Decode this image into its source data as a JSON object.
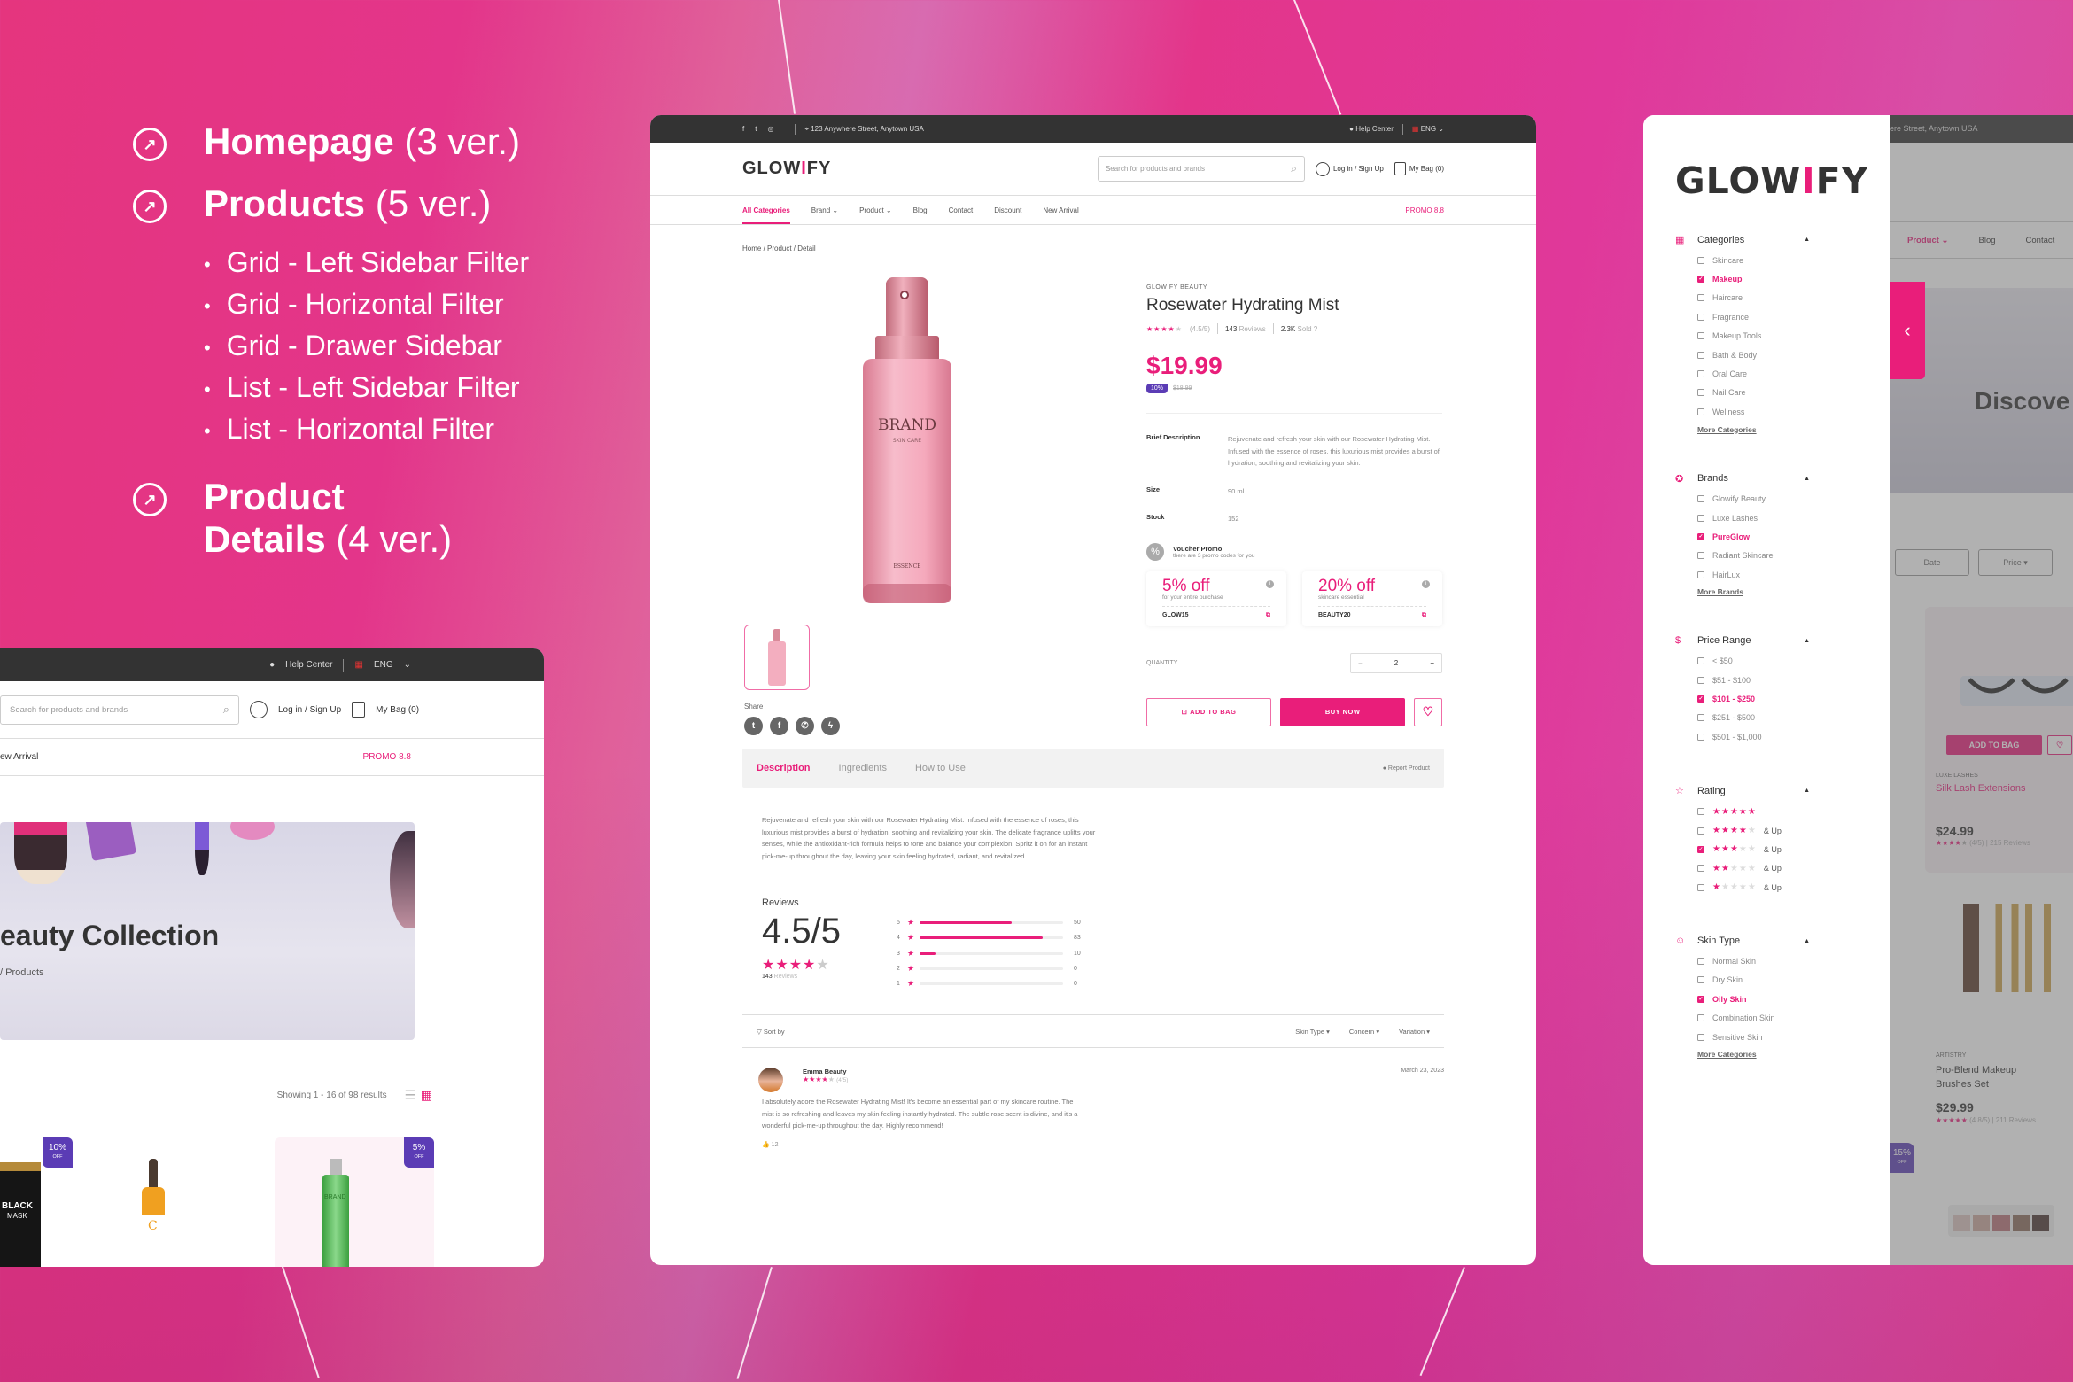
{
  "features": [
    {
      "title": "Homepage",
      "version": "(3 ver.)",
      "icon": "arrow-up-right-circle-icon",
      "items": []
    },
    {
      "title": "Products",
      "version": "(5 ver.)",
      "icon": "arrow-up-right-circle-icon",
      "items": [
        "Grid - Left Sidebar Filter",
        "Grid - Horizontal Filter",
        "Grid - Drawer Sidebar",
        "List - Left Sidebar Filter",
        "List - Horizontal Filter"
      ]
    },
    {
      "title": "Product",
      "title2": "Details",
      "version": "(4 ver.)",
      "icon": "arrow-up-right-circle-icon",
      "items": []
    }
  ],
  "brand": {
    "logo_pre": "GLOW",
    "logo_mark": "I",
    "logo_post": "FY",
    "accent": "#e91e7a",
    "badge_color": "#5b3cb5"
  },
  "topbar": {
    "address": "123 Anywhere Street, Anytown USA",
    "help": "Help Center",
    "lang": "ENG"
  },
  "header": {
    "search_placeholder": "Search for products and brands",
    "login": "Log in / Sign Up",
    "bag": "My Bag (0)"
  },
  "nav": {
    "items": [
      "All Categories",
      "Brand",
      "Product",
      "Blog",
      "Contact",
      "Discount",
      "New Arrival"
    ],
    "promo": "PROMO 8.8"
  },
  "detail": {
    "breadcrumb": "Home / Product / Detail",
    "image_text": {
      "brand": "BRAND",
      "line": "SKIN CARE",
      "essence": "ESSENCE"
    },
    "share_label": "Share",
    "brand": "GLOWIFY BEAUTY",
    "name": "Rosewater Hydrating Mist",
    "rating": 4.5,
    "rating_text": "(4.5/5)",
    "reviews_count": "143",
    "reviews_label": "Reviews",
    "sold": "2.3K",
    "sold_label": "Sold",
    "price": "$19.99",
    "discount": "10%",
    "old_price": "$18.99",
    "brief_label": "Brief Description",
    "brief": "Rejuvenate and refresh your skin with our Rosewater Hydrating Mist. Infused with the essence of roses, this luxurious mist provides a burst of hydration, soothing and revitalizing your skin.",
    "size_label": "Size",
    "size": "90 ml",
    "stock_label": "Stock",
    "stock": "152",
    "voucher_title": "Voucher Promo",
    "voucher_sub": "there are 3 promo codes for you",
    "vouchers": [
      {
        "pct": "5% off",
        "desc": "for your entire purchase",
        "code": "GLOW15"
      },
      {
        "pct": "20% off",
        "desc": "skincare essential",
        "code": "BEAUTY20"
      }
    ],
    "quantity_label": "QUANTITY",
    "quantity": "2",
    "add_to_bag": "ADD TO BAG",
    "buy_now": "BUY NOW",
    "tabs": [
      "Description",
      "Ingredients",
      "How to Use"
    ],
    "report": "Report Product",
    "description": "Rejuvenate and refresh your skin with our Rosewater Hydrating Mist. Infused with the essence of roses, this luxurious mist provides a burst of hydration, soothing and revitalizing your skin. The delicate fragrance uplifts your senses, while the antioxidant-rich formula helps to tone and balance your complexion. Spritz it on for an instant pick-me-up throughout the day, leaving your skin feeling hydrated, radiant, and revitalized."
  },
  "reviews": {
    "title": "Reviews",
    "score": "4.5/5",
    "count": "143",
    "count_label": "Reviews",
    "breakdown": [
      {
        "star": "5",
        "count": 50,
        "fill": 0.64
      },
      {
        "star": "4",
        "count": 83,
        "fill": 0.86
      },
      {
        "star": "3",
        "count": 10,
        "fill": 0.11
      },
      {
        "star": "2",
        "count": 0,
        "fill": 0
      },
      {
        "star": "1",
        "count": 0,
        "fill": 0
      }
    ],
    "sort_label": "Sort by",
    "filters": [
      "Skin Type",
      "Concern",
      "Variation"
    ],
    "items": [
      {
        "name": "Emma Beauty",
        "rating_text": "(4/5)",
        "date": "March 23, 2023",
        "text": "I absolutely adore the Rosewater Hydrating Mist! It's become an essential part of my skincare routine. The mist is so refreshing and leaves my skin feeling instantly hydrated. The subtle rose scent is divine, and it's a wonderful pick-me-up throughout the day. Highly recommend!",
        "likes": "12"
      }
    ]
  },
  "listing": {
    "nav_visible": "ew Arrival",
    "hero_title": "eauty Collection",
    "hero_crumb": "/ Products",
    "results": "Showing 1 - 16 of 98 results",
    "badges": [
      {
        "pct": "10%",
        "off": "OFF"
      },
      {
        "pct": "5%",
        "off": "OFF"
      }
    ],
    "products_img_text": [
      "BLACK",
      "MASK",
      "BRAND",
      "C",
      "BRAND"
    ]
  },
  "drawer": {
    "groups": [
      {
        "title": "Categories",
        "icon": "grid-icon",
        "options": [
          {
            "label": "Skincare",
            "checked": false
          },
          {
            "label": "Makeup",
            "checked": true
          },
          {
            "label": "Haircare",
            "checked": false
          },
          {
            "label": "Fragrance",
            "checked": false
          },
          {
            "label": "Makeup Tools",
            "checked": false
          },
          {
            "label": "Bath & Body",
            "checked": false
          },
          {
            "label": "Oral Care",
            "checked": false
          },
          {
            "label": "Nail Care",
            "checked": false
          },
          {
            "label": "Wellness",
            "checked": false
          }
        ],
        "more": "More Categories"
      },
      {
        "title": "Brands",
        "icon": "award-icon",
        "options": [
          {
            "label": "Glowify Beauty",
            "checked": false
          },
          {
            "label": "Luxe Lashes",
            "checked": false
          },
          {
            "label": "PureGlow",
            "checked": true
          },
          {
            "label": "Radiant Skincare",
            "checked": false
          },
          {
            "label": "HairLux",
            "checked": false
          }
        ],
        "more": "More Brands"
      },
      {
        "title": "Price Range",
        "icon": "dollar-circle-icon",
        "options": [
          {
            "label": "< $50",
            "checked": false
          },
          {
            "label": "$51 - $100",
            "checked": false
          },
          {
            "label": "$101 - $250",
            "checked": true
          },
          {
            "label": "$251 - $500",
            "checked": false
          },
          {
            "label": "$501 - $1,000",
            "checked": false
          }
        ]
      },
      {
        "title": "Rating",
        "icon": "star-outline-icon",
        "ratings": [
          {
            "stars": 5,
            "suffix": "",
            "checked": false
          },
          {
            "stars": 4,
            "suffix": "& Up",
            "checked": false
          },
          {
            "stars": 3,
            "suffix": "& Up",
            "checked": true
          },
          {
            "stars": 2,
            "suffix": "& Up",
            "checked": false
          },
          {
            "stars": 1,
            "suffix": "& Up",
            "checked": false
          }
        ]
      },
      {
        "title": "Skin Type",
        "icon": "face-scan-icon",
        "options": [
          {
            "label": "Normal Skin",
            "checked": false
          },
          {
            "label": "Dry Skin",
            "checked": false
          },
          {
            "label": "Oily Skin",
            "checked": true
          },
          {
            "label": "Combination Skin",
            "checked": false
          },
          {
            "label": "Sensitive Skin",
            "checked": false
          }
        ],
        "more": "More Categories"
      }
    ]
  },
  "behind": {
    "address_partial": "ere Street, Anytown USA",
    "nav": [
      "Product",
      "Blog",
      "Contact"
    ],
    "hero_partial": "Discove",
    "filters": [
      "Date",
      "Price"
    ],
    "products": [
      {
        "brand": "LUXE LASHES",
        "name": "Silk Lash Extensions",
        "price": "$24.99",
        "rating": "(4/5) | 215 Reviews",
        "add": "ADD TO BAG"
      },
      {
        "brand": "ARTISTRY",
        "name": "Pro-Blend Makeup Brushes Set",
        "price": "$29.99",
        "rating": "(4.8/5) | 211 Reviews"
      }
    ],
    "badge": {
      "pct": "15%",
      "off": "OFF"
    }
  }
}
